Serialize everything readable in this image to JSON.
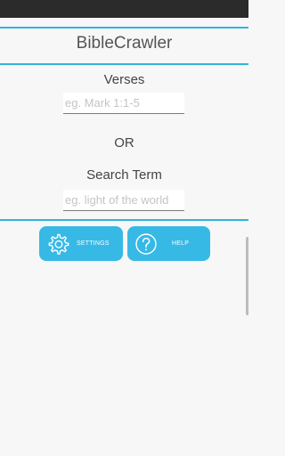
{
  "app": {
    "title": "BibleCrawler"
  },
  "verses": {
    "label": "Verses",
    "placeholder": "eg. Mark 1:1-5",
    "value": ""
  },
  "separator": {
    "text": "OR"
  },
  "search": {
    "label": "Search Term",
    "placeholder": "eg. light of the world",
    "value": ""
  },
  "buttons": {
    "settings": {
      "label": "SETTINGS",
      "icon": "gear-icon"
    },
    "help": {
      "label": "HELP",
      "icon": "question-circle-icon"
    }
  },
  "colors": {
    "accent": "#2fb4dc",
    "button": "#37b9e6",
    "statusbar": "#2b2b2b",
    "background": "#f7f7f7"
  }
}
